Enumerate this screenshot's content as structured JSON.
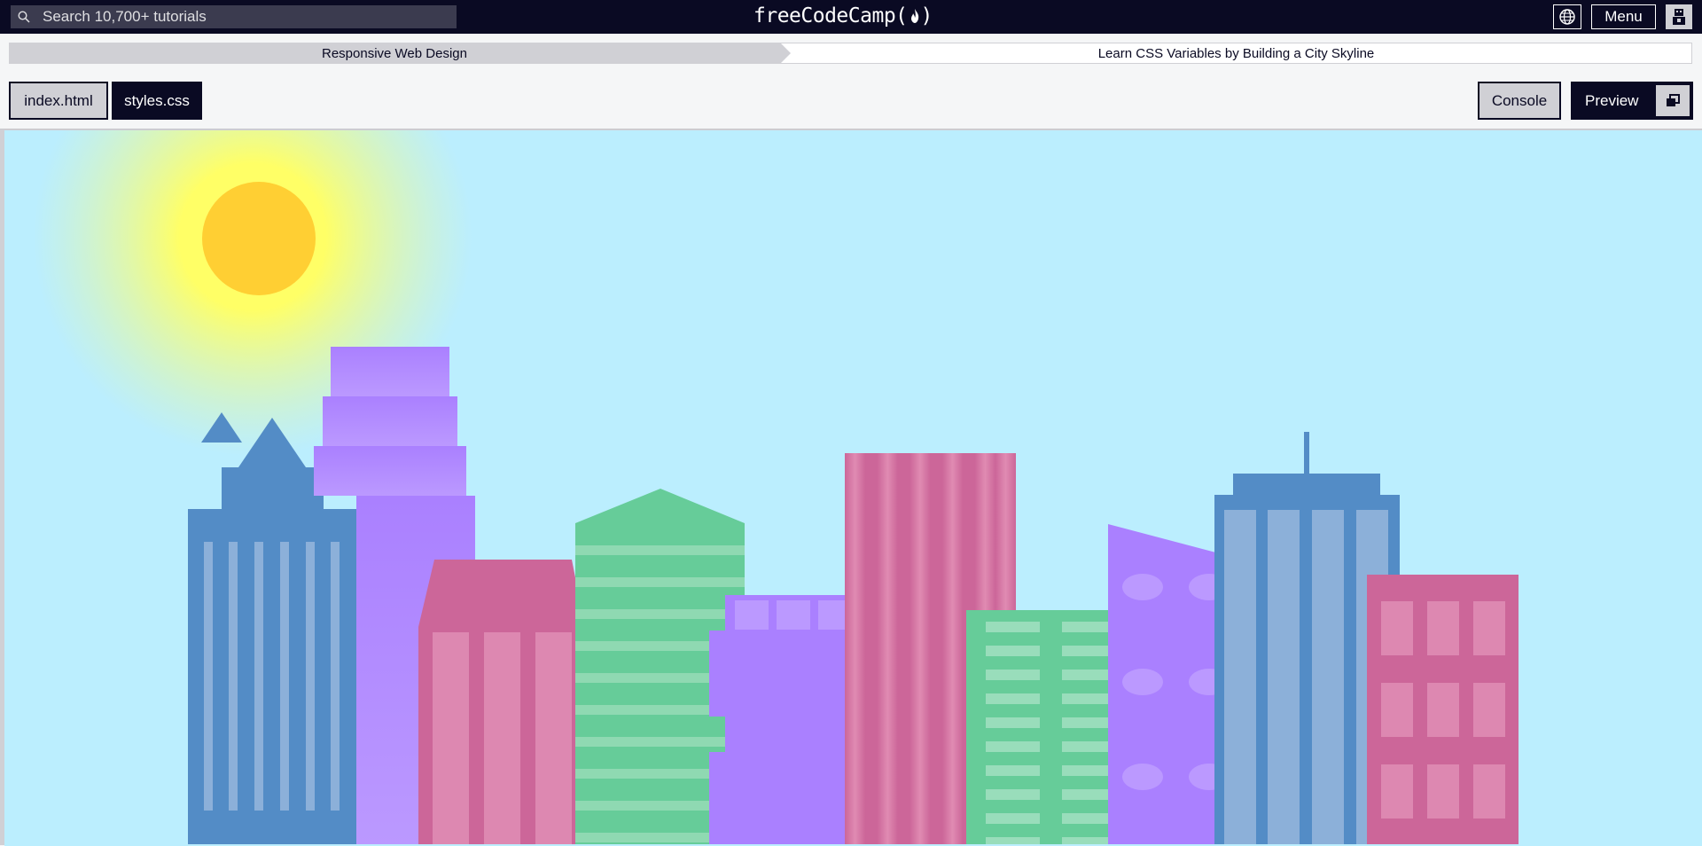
{
  "navbar": {
    "search_placeholder": "Search 10,700+ tutorials",
    "logo_text": "freeCodeCamp(",
    "logo_close": ")",
    "menu_label": "Menu"
  },
  "breadcrumb": {
    "superblock": "Responsive Web Design",
    "block": "Learn CSS Variables by Building a City Skyline"
  },
  "tabs": {
    "index": "index.html",
    "styles": "styles.css",
    "console": "Console",
    "preview": "Preview"
  },
  "colors": {
    "nav_bg": "#0a0a23",
    "sky": "#bbeefe",
    "sun": "#ffcf33",
    "sun_glow": "#ffff66",
    "building_blue": "#538cc6",
    "building_purple": "#aa80ff",
    "building_pink": "#cc6699",
    "building_green": "#66cc99"
  },
  "icons": [
    "search-icon",
    "fire-icon",
    "globe-icon",
    "avatar-icon",
    "pop-out-icon"
  ]
}
